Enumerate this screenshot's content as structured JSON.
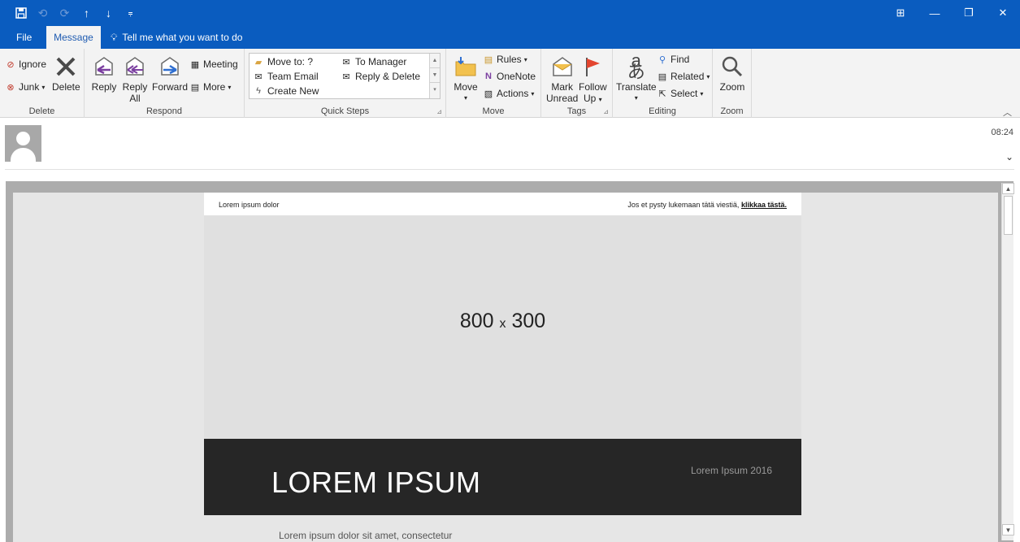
{
  "titlebar": {
    "qat_icons": [
      "save-icon",
      "undo-icon",
      "redo-icon",
      "up-arrow-icon",
      "down-arrow-icon",
      "customize-icon"
    ],
    "window_controls": [
      "ribbon-display-icon",
      "minimize-icon",
      "restore-icon",
      "close-icon"
    ]
  },
  "tabs": {
    "file": "File",
    "message": "Message",
    "tell_me": "Tell me what you want to do"
  },
  "ribbon": {
    "delete": {
      "label": "Delete",
      "ignore": "Ignore",
      "junk": "Junk",
      "delete": "Delete"
    },
    "respond": {
      "label": "Respond",
      "reply": "Reply",
      "reply_all_1": "Reply",
      "reply_all_2": "All",
      "forward": "Forward",
      "meeting": "Meeting",
      "more": "More"
    },
    "quick_steps": {
      "label": "Quick Steps",
      "items": [
        "Move to: ?",
        "Team Email",
        "Create New",
        "To Manager",
        "Reply & Delete"
      ]
    },
    "move": {
      "label": "Move",
      "move": "Move",
      "rules": "Rules",
      "onenote": "OneNote",
      "actions": "Actions"
    },
    "tags": {
      "label": "Tags",
      "mark_unread_1": "Mark",
      "mark_unread_2": "Unread",
      "follow_up_1": "Follow",
      "follow_up_2": "Up"
    },
    "editing": {
      "label": "Editing",
      "translate": "Translate",
      "find": "Find",
      "related": "Related",
      "select": "Select"
    },
    "zoom": {
      "label": "Zoom",
      "zoom": "Zoom"
    }
  },
  "header": {
    "time": "08:24"
  },
  "email": {
    "preheader_left": "Lorem ipsum dolor",
    "preheader_right": "Jos et pysty lukemaan tätä viestiä,",
    "preheader_link": "klikkaa tästä.",
    "hero_w": "800",
    "hero_x": "x",
    "hero_h": "300",
    "banner_title": "LOREM IPSUM",
    "banner_year": "Lorem Ipsum 2016",
    "body_text": "Lorem ipsum dolor sit amet, consectetur"
  }
}
